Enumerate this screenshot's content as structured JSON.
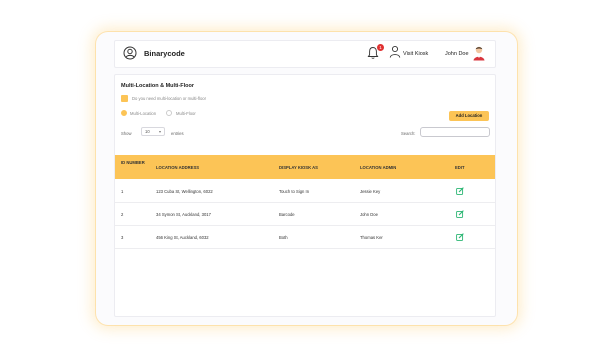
{
  "header": {
    "brand": "Binarycode",
    "notification_count": "1",
    "visit_kiosk": "Visit Kiosk",
    "user_name": "John Doe"
  },
  "card": {
    "title": "Multi-Location & Multi-Floor",
    "checkbox_label": "Do you need multi-location or multi-floor",
    "radio_multi_location": "Multi-Location",
    "radio_multi_floor": "Multi-Floor",
    "add_button": "Add Location",
    "show_label": "Show",
    "show_value": "10",
    "entries_label": "entries",
    "search_label": "Search:",
    "search_value": ""
  },
  "table": {
    "columns": [
      "ID NUMBER",
      "LOCATION ADDRESS",
      "DISPLAY KIOSK AS",
      "LOCATION ADMIN",
      "EDIT"
    ],
    "rows": [
      {
        "id": "1",
        "address": "123 Cuba St, Wellington, 6022",
        "display": "Touch to Sign In",
        "admin": "Jessie Key"
      },
      {
        "id": "2",
        "address": "34 Symon St, Auckland, 3017",
        "display": "Barcode",
        "admin": "John Doe"
      },
      {
        "id": "3",
        "address": "456 King St, Auckland, 6032",
        "display": "Both",
        "admin": "Thomas Ker"
      }
    ]
  },
  "colors": {
    "accent": "#fcc456",
    "edit_icon": "#2bb673",
    "badge": "#e03131"
  }
}
